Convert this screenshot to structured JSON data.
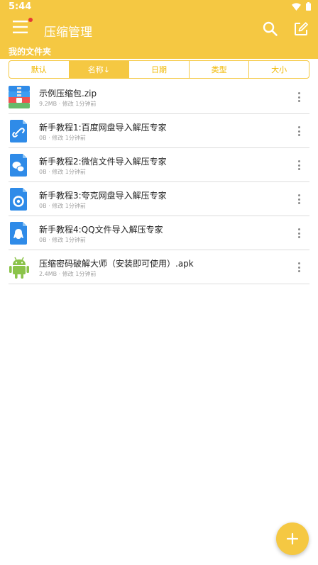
{
  "status": {
    "time": "5:44"
  },
  "appbar": {
    "title": "压缩管理",
    "folder_label": "我的文件夹"
  },
  "sort_tabs": [
    "默认",
    "名称↓",
    "日期",
    "类型",
    "大小"
  ],
  "active_sort_index": 1,
  "files": [
    {
      "name": "示例压缩包.zip",
      "meta": "9.2MB · 修改 1分钟前",
      "icon": "zip-archive-icon"
    },
    {
      "name": "新手教程1:百度网盘导入解压专家",
      "meta": "0B · 修改 1分钟前",
      "icon": "link-document-icon"
    },
    {
      "name": "新手教程2:微信文件导入解压专家",
      "meta": "0B · 修改 1分钟前",
      "icon": "wechat-document-icon"
    },
    {
      "name": "新手教程3:夸克网盘导入解压专家",
      "meta": "0B · 修改 1分钟前",
      "icon": "quark-document-icon"
    },
    {
      "name": "新手教程4:QQ文件导入解压专家",
      "meta": "0B · 修改 1分钟前",
      "icon": "qq-document-icon"
    },
    {
      "name": "压缩密码破解大师（安装即可使用）.apk",
      "meta": "2.4MB · 修改 1分钟前",
      "icon": "android-icon"
    }
  ],
  "colors": {
    "accent": "#f5c842",
    "doc_blue": "#2f8be8",
    "android_green": "#8bc34a"
  }
}
